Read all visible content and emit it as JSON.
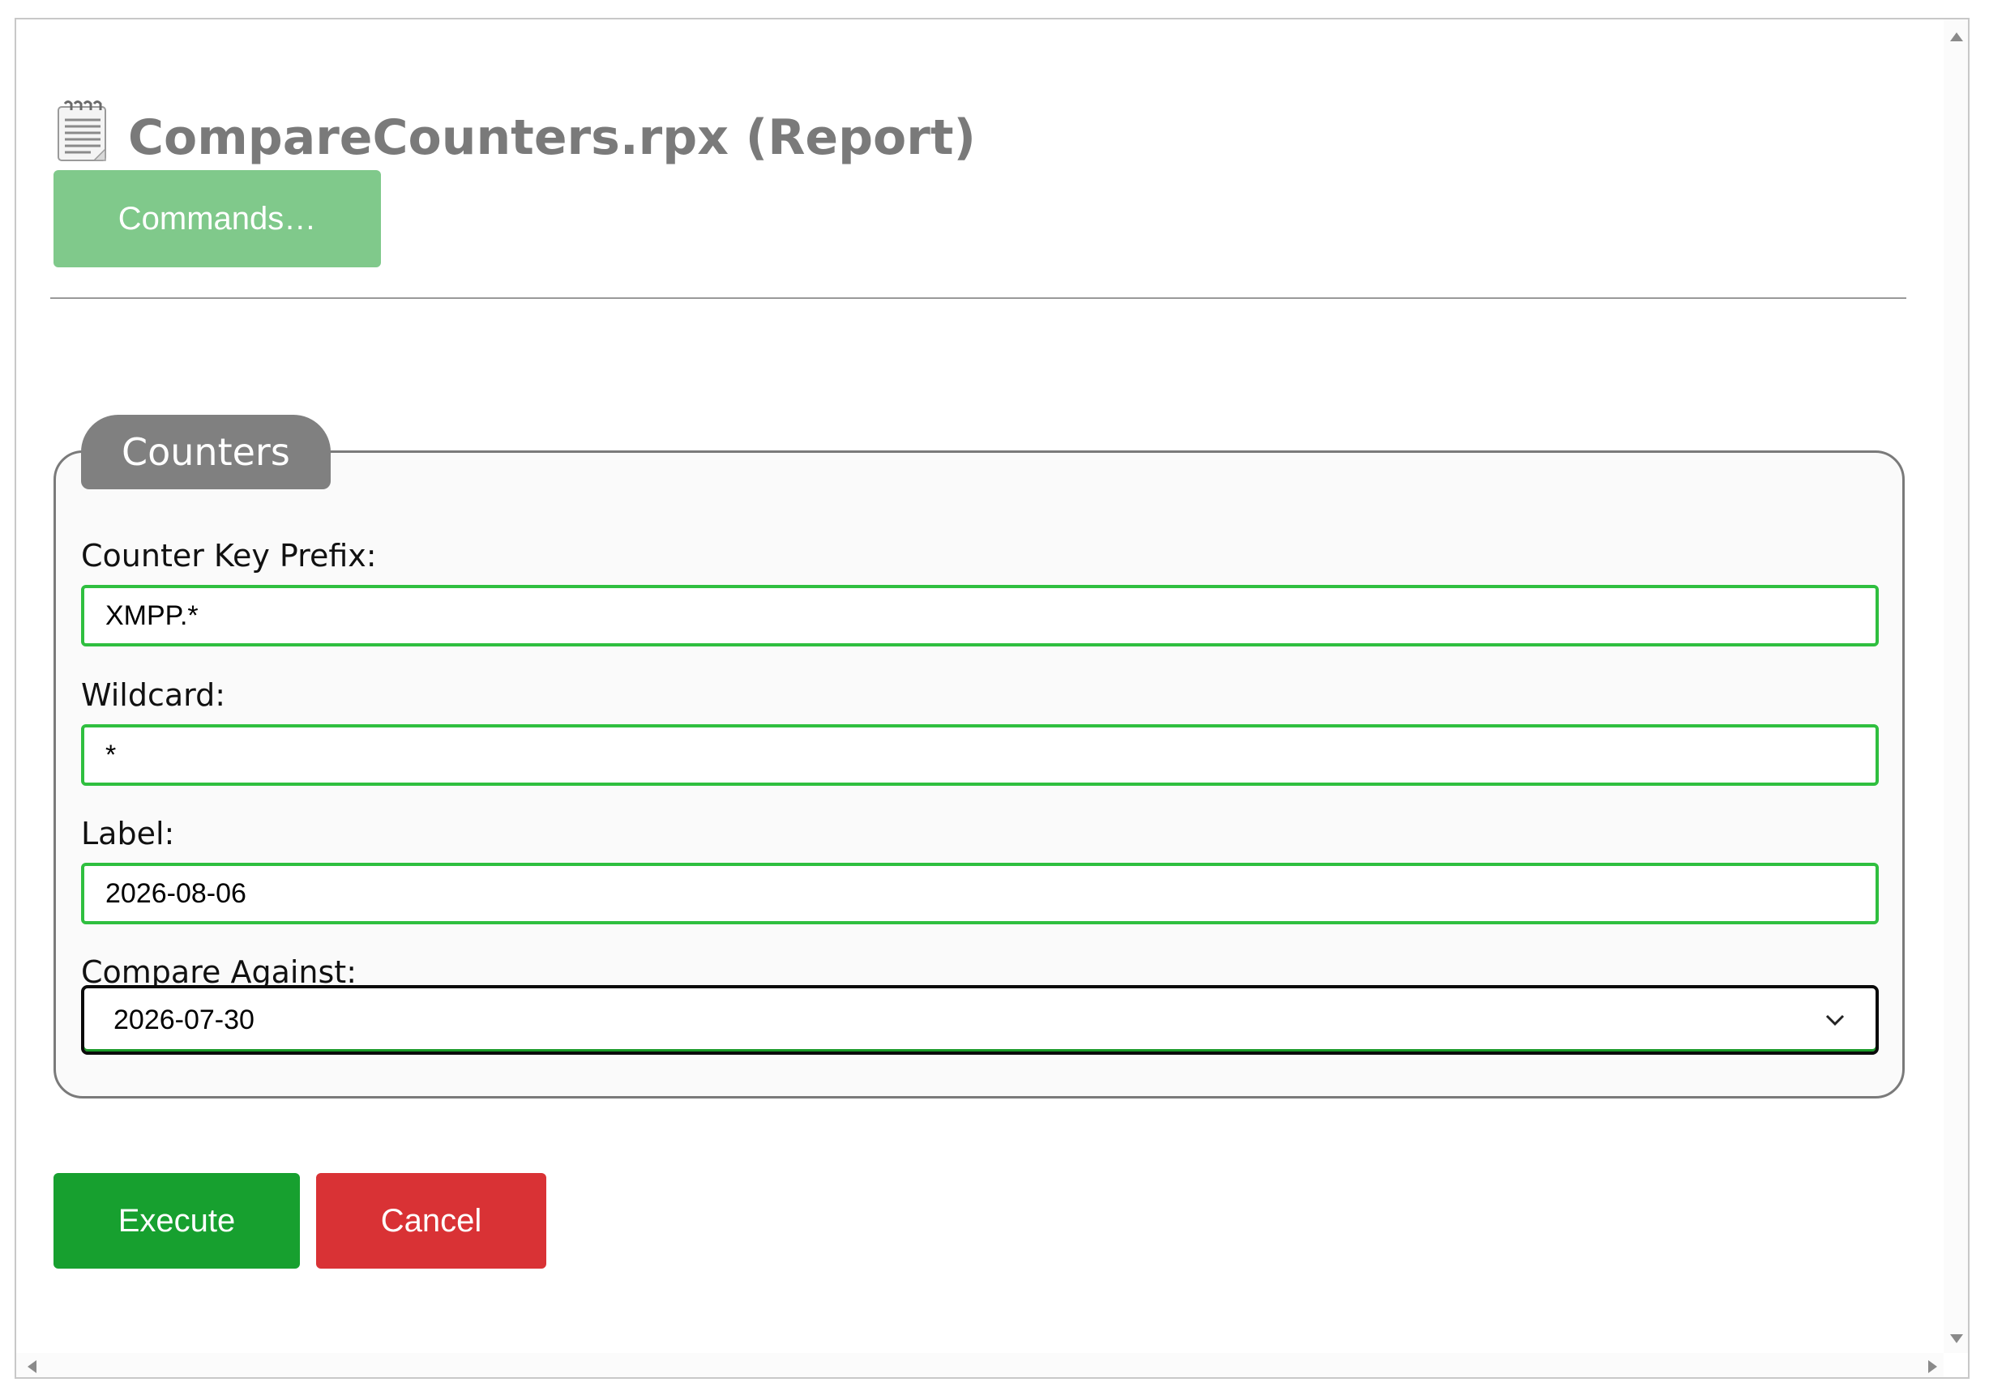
{
  "header": {
    "title": "CompareCounters.rpx (Report)",
    "icon": "notepad-icon",
    "commands_label": "Commands…"
  },
  "counters": {
    "legend": "Counters",
    "fields": [
      {
        "label": "Counter Key Prefix:",
        "value": "XMPP.*"
      },
      {
        "label": "Wildcard:",
        "value": "*"
      },
      {
        "label": "Label:",
        "value": "2026-08-06"
      }
    ],
    "compare_against": {
      "label": "Compare Against:",
      "selected": "2026-07-30"
    }
  },
  "actions": {
    "execute_label": "Execute",
    "cancel_label": "Cancel"
  },
  "colors": {
    "commands_bg": "#80c98b",
    "execute_bg": "#17a02f",
    "cancel_bg": "#d93235",
    "input_border": "#2fbf3f",
    "legend_bg": "#808080"
  }
}
